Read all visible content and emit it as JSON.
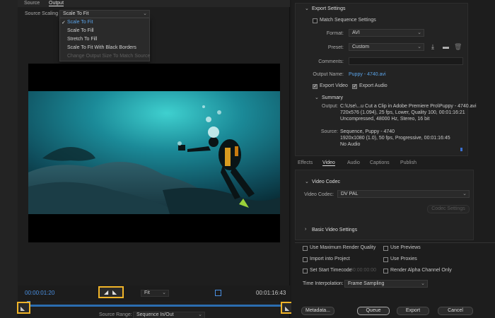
{
  "tabs": {
    "source": "Source",
    "output": "Output"
  },
  "scaling": {
    "label": "Source Scaling",
    "value": "Scale To Fit",
    "options": [
      "Scale To Fit",
      "Scale To Fill",
      "Stretch To Fill",
      "Scale To Fit With Black Borders",
      "Change Output Size To Match Source"
    ]
  },
  "playback": {
    "current_time": "00:00:01:20",
    "end_time": "00:01:16:43",
    "fit": "Fit",
    "source_range_label": "Source Range:",
    "source_range": "Sequence In/Out"
  },
  "export_settings": {
    "heading": "Export Settings",
    "match_sequence": "Match Sequence Settings",
    "format_label": "Format:",
    "format_value": "AVI",
    "preset_label": "Preset:",
    "preset_value": "Custom",
    "comments_label": "Comments:",
    "output_name_label": "Output Name:",
    "output_name": "Puppy - 4740.avi",
    "export_video": "Export Video",
    "export_audio": "Export Audio",
    "summary_heading": "Summary",
    "output_label": "Output:",
    "output_lines": [
      "C:\\Use\\...u Cut a Clip in Adobe Premiere Pro\\Puppy - 4740.avi",
      "720x576 (1.094), 25 fps, Lower, Quality 100, 00:01:16:21",
      "Uncompressed, 48000 Hz, Stereo, 16 bit"
    ],
    "source_label": "Source:",
    "source_lines": [
      "Sequence, Puppy - 4740",
      "1920x1080 (1.0), 50 fps, Progressive, 00:01:16:45",
      "No Audio"
    ]
  },
  "format_tabs": [
    "Effects",
    "Video",
    "Audio",
    "Captions",
    "Publish"
  ],
  "video_codec": {
    "heading": "Video Codec",
    "codec_label": "Video Codec:",
    "codec_value": "DV PAL",
    "codec_settings": "Codec Settings"
  },
  "basic_video": "Basic Video Settings",
  "options": {
    "max_render": "Use Maximum Render Quality",
    "use_previews": "Use Previews",
    "import_project": "Import into Project",
    "use_proxies": "Use Proxies",
    "set_start_tc": "Set Start Timecode",
    "start_tc_value": "00:00:00:00",
    "render_alpha": "Render Alpha Channel Only",
    "time_interp_label": "Time Interpolation:",
    "time_interp_value": "Frame Sampling"
  },
  "buttons": {
    "metadata": "Metadata...",
    "queue": "Queue",
    "export": "Export",
    "cancel": "Cancel"
  },
  "colors": {
    "accent": "#4a90e2",
    "highlight": "#f0b429",
    "water": "#1d8a96"
  }
}
